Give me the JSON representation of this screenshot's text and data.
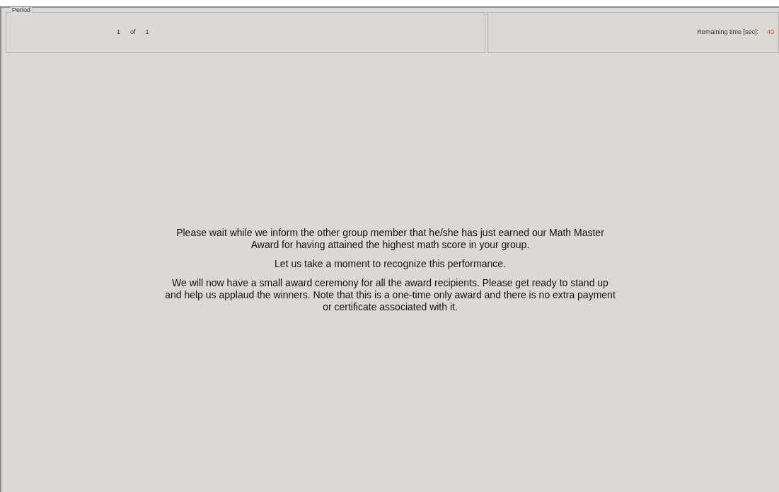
{
  "period": {
    "legend": "Period",
    "current": "1",
    "separator": "of",
    "total": "1"
  },
  "timer": {
    "label": "Remaining time [sec]:",
    "value": "40"
  },
  "message": [
    "Please wait while we inform the other group member that he/she has just earned our Math Master Award for having attained the highest math score in your group.",
    "Let us take a moment to recognize this performance.",
    "We will now have a small award ceremony for all the award recipients. Please get ready to stand up and help us applaud the winners. Note that this is a one-time only award and there is no extra payment or certificate associated with it."
  ]
}
